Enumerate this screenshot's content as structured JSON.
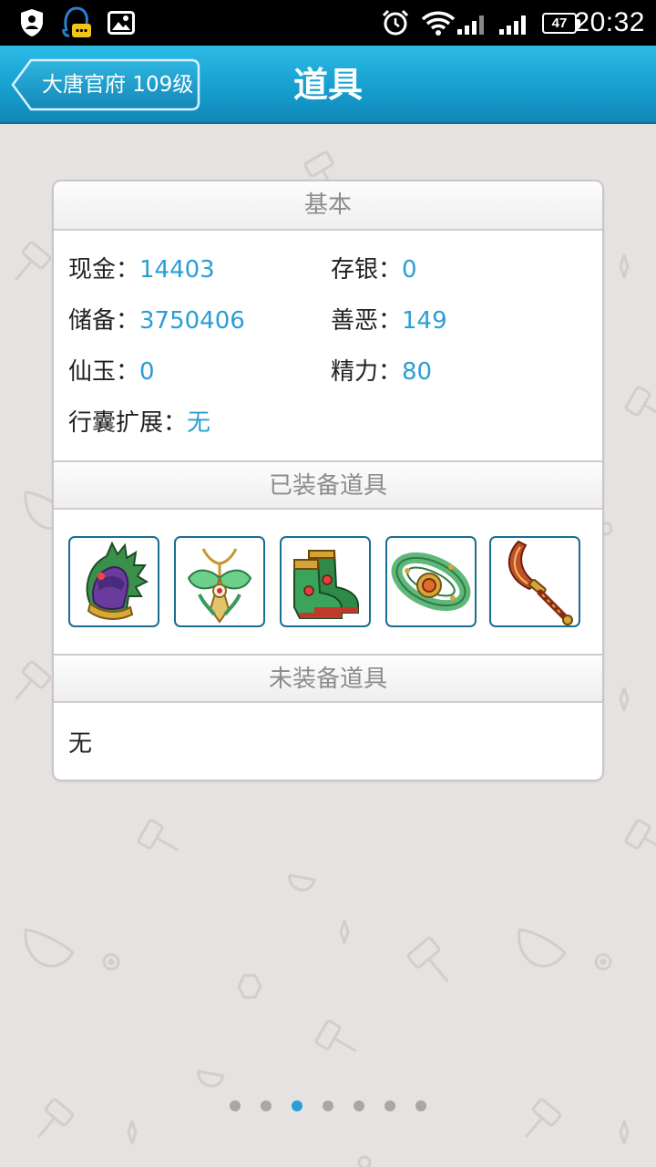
{
  "status_bar": {
    "time": "20:32",
    "battery": "47",
    "icons": [
      "shield-icon",
      "chat-bubble-icon",
      "image-icon",
      "alarm-icon",
      "wifi-icon",
      "signal-icon",
      "signal-icon",
      "battery-icon"
    ]
  },
  "header": {
    "back_label": "大唐官府 109级",
    "title": "道具"
  },
  "basic": {
    "title": "基本",
    "cash_label": "现金：",
    "cash_value": "14403",
    "deposit_label": "存银：",
    "deposit_value": "0",
    "reserve_label": "储备：",
    "reserve_value": "3750406",
    "karma_label": "善恶：",
    "karma_value": "149",
    "jade_label": "仙玉：",
    "jade_value": "0",
    "energy_label": "精力：",
    "energy_value": "80",
    "bag_label": "行囊扩展：",
    "bag_value": "无"
  },
  "equipped": {
    "title": "已装备道具",
    "items": [
      "helmet-item",
      "necklace-item",
      "boots-item",
      "belt-item",
      "sword-item"
    ]
  },
  "unequipped": {
    "title": "未装备道具",
    "empty_text": "无"
  },
  "pager": {
    "count": 7,
    "active_index": 2
  },
  "colors": {
    "accent": "#2a9ed4",
    "titlebar": "#169fcf",
    "background": "#e6e2e1"
  }
}
